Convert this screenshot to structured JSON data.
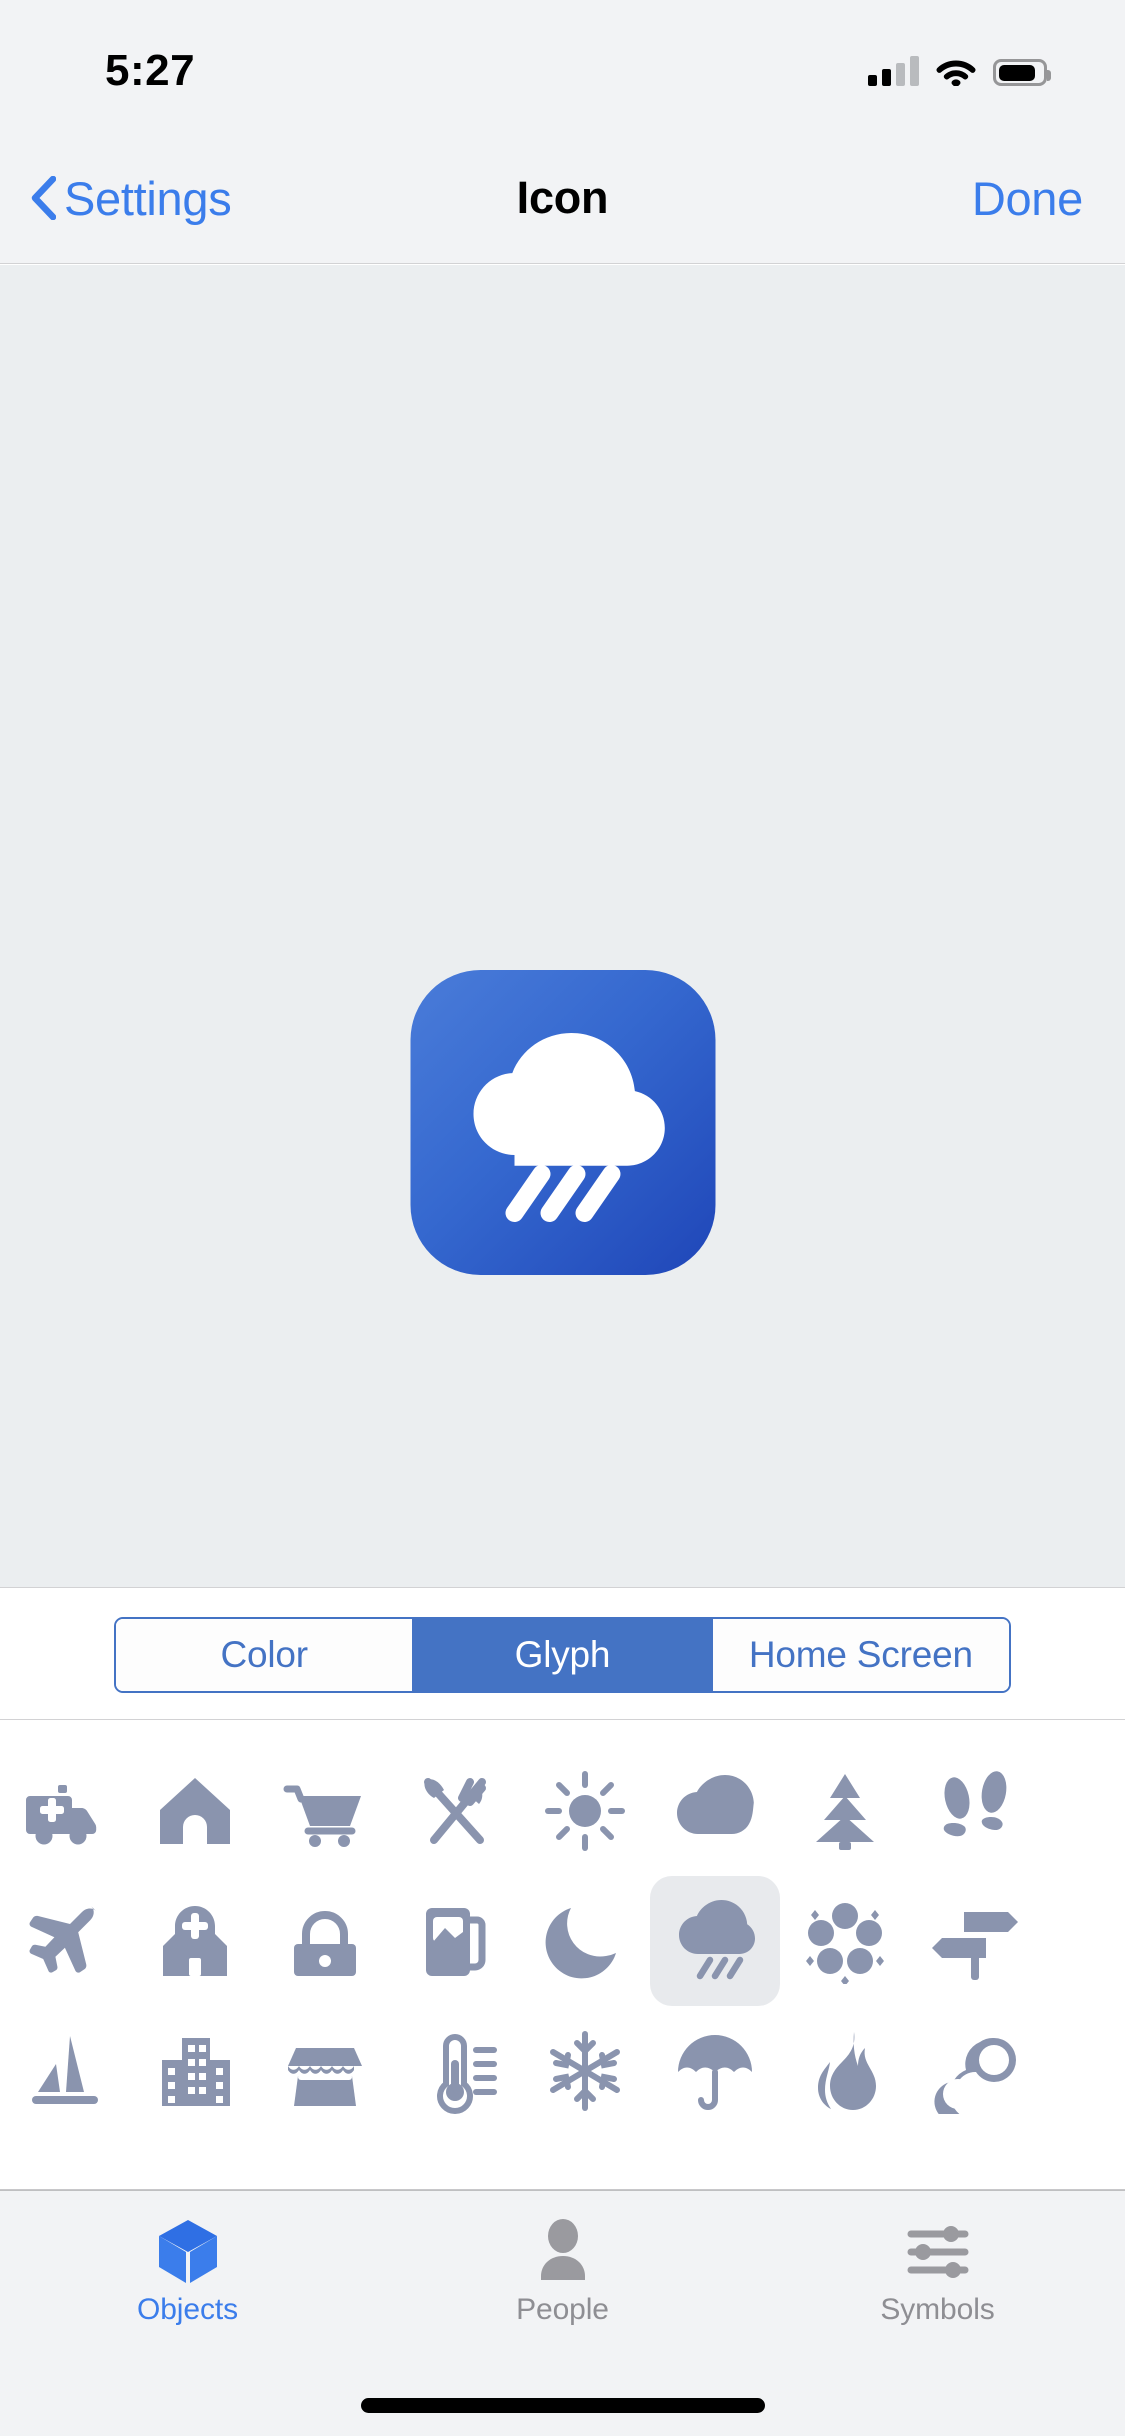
{
  "status_bar": {
    "time": "5:27",
    "cellular_icon": "cellular-signal-icon",
    "cellular_bars_filled": 2,
    "cellular_bars_total": 4,
    "wifi_icon": "wifi-icon",
    "battery_icon": "battery-icon",
    "battery_level_percent": 72
  },
  "nav_bar": {
    "back_icon": "chevron-left-icon",
    "back_label": "Settings",
    "title": "Icon",
    "done_label": "Done"
  },
  "preview": {
    "icon_name": "app-icon-preview",
    "glyph": "cloud-rain-glyph",
    "background_gradient_from": "#4A7CD9",
    "background_gradient_to": "#1F46B8",
    "glyph_color": "#FFFFFF",
    "surface_color": "#EBEEF0"
  },
  "segmented_control": {
    "selected_index": 1,
    "accent_color": "#4473C4",
    "segments": [
      {
        "label": "Color"
      },
      {
        "label": "Glyph"
      },
      {
        "label": "Home Screen"
      }
    ]
  },
  "glyph_grid": {
    "glyph_color": "#8A94AE",
    "selection_background": "#E8EAED",
    "selected_glyph": "cloud-rain",
    "rows": [
      [
        {
          "name": "ambulance"
        },
        {
          "name": "house"
        },
        {
          "name": "shopping-cart"
        },
        {
          "name": "knife-and-fork"
        },
        {
          "name": "sun"
        },
        {
          "name": "cloud"
        },
        {
          "name": "pine-tree"
        },
        {
          "name": "footprints"
        }
      ],
      [
        {
          "name": "airplane"
        },
        {
          "name": "hospital"
        },
        {
          "name": "handbag"
        },
        {
          "name": "gas-pump"
        },
        {
          "name": "moon"
        },
        {
          "name": "cloud-rain",
          "selected": true
        },
        {
          "name": "flower"
        },
        {
          "name": "signpost"
        }
      ],
      [
        {
          "name": "sailboat"
        },
        {
          "name": "buildings"
        },
        {
          "name": "market-stall"
        },
        {
          "name": "thermometer"
        },
        {
          "name": "snowflake"
        },
        {
          "name": "umbrella"
        },
        {
          "name": "flame"
        },
        {
          "name": "bubbles"
        }
      ]
    ]
  },
  "tab_bar": {
    "selected_index": 0,
    "active_color": "#3B7DEB",
    "inactive_color": "#8E8E93",
    "tabs": [
      {
        "label": "Objects",
        "icon": "cube-icon"
      },
      {
        "label": "People",
        "icon": "person-icon"
      },
      {
        "label": "Symbols",
        "icon": "sliders-icon"
      }
    ]
  },
  "home_indicator": {
    "name": "home-indicator"
  }
}
